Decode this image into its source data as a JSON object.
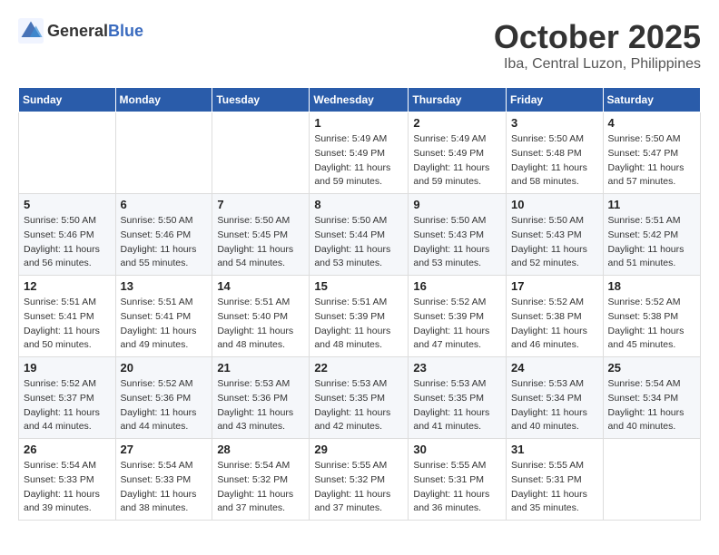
{
  "header": {
    "logo_general": "General",
    "logo_blue": "Blue",
    "month": "October 2025",
    "location": "Iba, Central Luzon, Philippines"
  },
  "days_of_week": [
    "Sunday",
    "Monday",
    "Tuesday",
    "Wednesday",
    "Thursday",
    "Friday",
    "Saturday"
  ],
  "weeks": [
    [
      {
        "day": "",
        "sunrise": "",
        "sunset": "",
        "daylight": ""
      },
      {
        "day": "",
        "sunrise": "",
        "sunset": "",
        "daylight": ""
      },
      {
        "day": "",
        "sunrise": "",
        "sunset": "",
        "daylight": ""
      },
      {
        "day": "1",
        "sunrise": "Sunrise: 5:49 AM",
        "sunset": "Sunset: 5:49 PM",
        "daylight": "Daylight: 11 hours and 59 minutes."
      },
      {
        "day": "2",
        "sunrise": "Sunrise: 5:49 AM",
        "sunset": "Sunset: 5:49 PM",
        "daylight": "Daylight: 11 hours and 59 minutes."
      },
      {
        "day": "3",
        "sunrise": "Sunrise: 5:50 AM",
        "sunset": "Sunset: 5:48 PM",
        "daylight": "Daylight: 11 hours and 58 minutes."
      },
      {
        "day": "4",
        "sunrise": "Sunrise: 5:50 AM",
        "sunset": "Sunset: 5:47 PM",
        "daylight": "Daylight: 11 hours and 57 minutes."
      }
    ],
    [
      {
        "day": "5",
        "sunrise": "Sunrise: 5:50 AM",
        "sunset": "Sunset: 5:46 PM",
        "daylight": "Daylight: 11 hours and 56 minutes."
      },
      {
        "day": "6",
        "sunrise": "Sunrise: 5:50 AM",
        "sunset": "Sunset: 5:46 PM",
        "daylight": "Daylight: 11 hours and 55 minutes."
      },
      {
        "day": "7",
        "sunrise": "Sunrise: 5:50 AM",
        "sunset": "Sunset: 5:45 PM",
        "daylight": "Daylight: 11 hours and 54 minutes."
      },
      {
        "day": "8",
        "sunrise": "Sunrise: 5:50 AM",
        "sunset": "Sunset: 5:44 PM",
        "daylight": "Daylight: 11 hours and 53 minutes."
      },
      {
        "day": "9",
        "sunrise": "Sunrise: 5:50 AM",
        "sunset": "Sunset: 5:43 PM",
        "daylight": "Daylight: 11 hours and 53 minutes."
      },
      {
        "day": "10",
        "sunrise": "Sunrise: 5:50 AM",
        "sunset": "Sunset: 5:43 PM",
        "daylight": "Daylight: 11 hours and 52 minutes."
      },
      {
        "day": "11",
        "sunrise": "Sunrise: 5:51 AM",
        "sunset": "Sunset: 5:42 PM",
        "daylight": "Daylight: 11 hours and 51 minutes."
      }
    ],
    [
      {
        "day": "12",
        "sunrise": "Sunrise: 5:51 AM",
        "sunset": "Sunset: 5:41 PM",
        "daylight": "Daylight: 11 hours and 50 minutes."
      },
      {
        "day": "13",
        "sunrise": "Sunrise: 5:51 AM",
        "sunset": "Sunset: 5:41 PM",
        "daylight": "Daylight: 11 hours and 49 minutes."
      },
      {
        "day": "14",
        "sunrise": "Sunrise: 5:51 AM",
        "sunset": "Sunset: 5:40 PM",
        "daylight": "Daylight: 11 hours and 48 minutes."
      },
      {
        "day": "15",
        "sunrise": "Sunrise: 5:51 AM",
        "sunset": "Sunset: 5:39 PM",
        "daylight": "Daylight: 11 hours and 48 minutes."
      },
      {
        "day": "16",
        "sunrise": "Sunrise: 5:52 AM",
        "sunset": "Sunset: 5:39 PM",
        "daylight": "Daylight: 11 hours and 47 minutes."
      },
      {
        "day": "17",
        "sunrise": "Sunrise: 5:52 AM",
        "sunset": "Sunset: 5:38 PM",
        "daylight": "Daylight: 11 hours and 46 minutes."
      },
      {
        "day": "18",
        "sunrise": "Sunrise: 5:52 AM",
        "sunset": "Sunset: 5:38 PM",
        "daylight": "Daylight: 11 hours and 45 minutes."
      }
    ],
    [
      {
        "day": "19",
        "sunrise": "Sunrise: 5:52 AM",
        "sunset": "Sunset: 5:37 PM",
        "daylight": "Daylight: 11 hours and 44 minutes."
      },
      {
        "day": "20",
        "sunrise": "Sunrise: 5:52 AM",
        "sunset": "Sunset: 5:36 PM",
        "daylight": "Daylight: 11 hours and 44 minutes."
      },
      {
        "day": "21",
        "sunrise": "Sunrise: 5:53 AM",
        "sunset": "Sunset: 5:36 PM",
        "daylight": "Daylight: 11 hours and 43 minutes."
      },
      {
        "day": "22",
        "sunrise": "Sunrise: 5:53 AM",
        "sunset": "Sunset: 5:35 PM",
        "daylight": "Daylight: 11 hours and 42 minutes."
      },
      {
        "day": "23",
        "sunrise": "Sunrise: 5:53 AM",
        "sunset": "Sunset: 5:35 PM",
        "daylight": "Daylight: 11 hours and 41 minutes."
      },
      {
        "day": "24",
        "sunrise": "Sunrise: 5:53 AM",
        "sunset": "Sunset: 5:34 PM",
        "daylight": "Daylight: 11 hours and 40 minutes."
      },
      {
        "day": "25",
        "sunrise": "Sunrise: 5:54 AM",
        "sunset": "Sunset: 5:34 PM",
        "daylight": "Daylight: 11 hours and 40 minutes."
      }
    ],
    [
      {
        "day": "26",
        "sunrise": "Sunrise: 5:54 AM",
        "sunset": "Sunset: 5:33 PM",
        "daylight": "Daylight: 11 hours and 39 minutes."
      },
      {
        "day": "27",
        "sunrise": "Sunrise: 5:54 AM",
        "sunset": "Sunset: 5:33 PM",
        "daylight": "Daylight: 11 hours and 38 minutes."
      },
      {
        "day": "28",
        "sunrise": "Sunrise: 5:54 AM",
        "sunset": "Sunset: 5:32 PM",
        "daylight": "Daylight: 11 hours and 37 minutes."
      },
      {
        "day": "29",
        "sunrise": "Sunrise: 5:55 AM",
        "sunset": "Sunset: 5:32 PM",
        "daylight": "Daylight: 11 hours and 37 minutes."
      },
      {
        "day": "30",
        "sunrise": "Sunrise: 5:55 AM",
        "sunset": "Sunset: 5:31 PM",
        "daylight": "Daylight: 11 hours and 36 minutes."
      },
      {
        "day": "31",
        "sunrise": "Sunrise: 5:55 AM",
        "sunset": "Sunset: 5:31 PM",
        "daylight": "Daylight: 11 hours and 35 minutes."
      },
      {
        "day": "",
        "sunrise": "",
        "sunset": "",
        "daylight": ""
      }
    ]
  ]
}
